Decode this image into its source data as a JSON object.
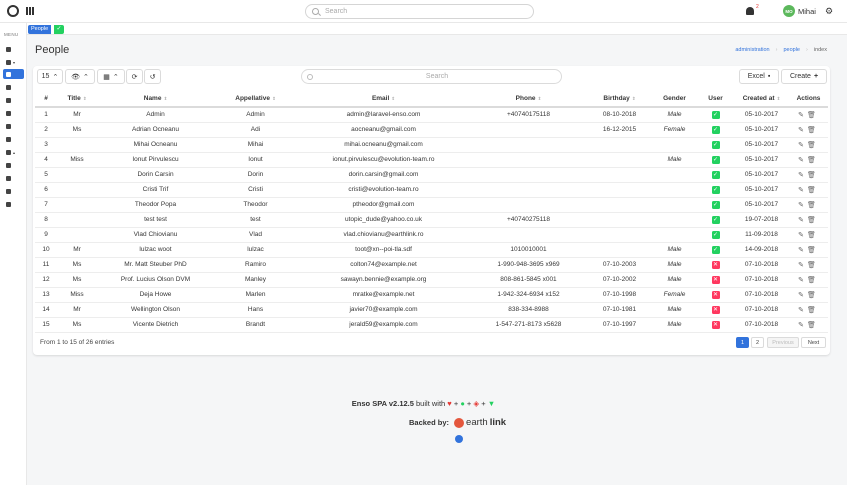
{
  "topbar": {
    "search_placeholder": "Search",
    "user": "Mihai",
    "avatar_initials": "MO",
    "notif_count": "2"
  },
  "sidebar": {
    "menu_label": "MENU"
  },
  "tabs": {
    "people": "People"
  },
  "page": {
    "title": "People",
    "breadcrumbs": [
      "administration",
      "people",
      "index"
    ]
  },
  "toolbar": {
    "per_page": "15",
    "search_placeholder": "Search",
    "excel": "Excel",
    "create": "Create"
  },
  "table": {
    "headers": [
      "#",
      "Title",
      "Name",
      "Appellative",
      "Email",
      "Phone",
      "Birthday",
      "Gender",
      "User",
      "Created at",
      "Actions"
    ],
    "rows": [
      {
        "n": "1",
        "title": "Mr",
        "name": "Admin",
        "app": "Admin",
        "email": "admin@laravel-enso.com",
        "phone": "+40740175118",
        "bday": "08-10-2018",
        "gender": "Male",
        "user": true,
        "created": "05-10-2017"
      },
      {
        "n": "2",
        "title": "Ms",
        "name": "Adrian Ocneanu",
        "app": "Adi",
        "email": "aocneanu@gmail.com",
        "phone": "",
        "bday": "16-12-2015",
        "gender": "Female",
        "user": true,
        "created": "05-10-2017"
      },
      {
        "n": "3",
        "title": "",
        "name": "Mihai Ocneanu",
        "app": "Mihai",
        "email": "mihai.ocneanu@gmail.com",
        "phone": "",
        "bday": "",
        "gender": "",
        "user": true,
        "created": "05-10-2017"
      },
      {
        "n": "4",
        "title": "Miss",
        "name": "Ionut Pirvulescu",
        "app": "Ionut",
        "email": "ionut.pirvulescu@evolution-team.ro",
        "phone": "",
        "bday": "",
        "gender": "Male",
        "user": true,
        "created": "05-10-2017"
      },
      {
        "n": "5",
        "title": "",
        "name": "Dorin Carsin",
        "app": "Dorin",
        "email": "dorin.carsin@gmail.com",
        "phone": "",
        "bday": "",
        "gender": "",
        "user": true,
        "created": "05-10-2017"
      },
      {
        "n": "6",
        "title": "",
        "name": "Cristi Trif",
        "app": "Cristi",
        "email": "cristi@evolution-team.ro",
        "phone": "",
        "bday": "",
        "gender": "",
        "user": true,
        "created": "05-10-2017"
      },
      {
        "n": "7",
        "title": "",
        "name": "Theodor Popa",
        "app": "Theodor",
        "email": "ptheodor@gmail.com",
        "phone": "",
        "bday": "",
        "gender": "",
        "user": true,
        "created": "05-10-2017"
      },
      {
        "n": "8",
        "title": "",
        "name": "test test",
        "app": "test",
        "email": "utopic_dude@yahoo.co.uk",
        "phone": "+40740275118",
        "bday": "",
        "gender": "",
        "user": true,
        "created": "19-07-2018"
      },
      {
        "n": "9",
        "title": "",
        "name": "Vlad Chiovianu",
        "app": "Vlad",
        "email": "vlad.chiovianu@earthlink.ro",
        "phone": "",
        "bday": "",
        "gender": "",
        "user": true,
        "created": "11-09-2018"
      },
      {
        "n": "10",
        "title": "Mr",
        "name": "lulzac woot",
        "app": "lulzac",
        "email": "toot@xn--poi-tla.sdf",
        "phone": "1010010001",
        "bday": "",
        "gender": "Male",
        "user": true,
        "created": "14-09-2018"
      },
      {
        "n": "11",
        "title": "Ms",
        "name": "Mr. Matt Steuber PhD",
        "app": "Ramiro",
        "email": "colton74@example.net",
        "phone": "1-990-948-3695 x969",
        "bday": "07-10-2003",
        "gender": "Male",
        "user": false,
        "created": "07-10-2018"
      },
      {
        "n": "12",
        "title": "Ms",
        "name": "Prof. Lucius Olson DVM",
        "app": "Manley",
        "email": "sawayn.bennie@example.org",
        "phone": "808-861-5845 x001",
        "bday": "07-10-2002",
        "gender": "Male",
        "user": false,
        "created": "07-10-2018"
      },
      {
        "n": "13",
        "title": "Miss",
        "name": "Deja Howe",
        "app": "Marlen",
        "email": "mratke@example.net",
        "phone": "1-942-324-6934 x152",
        "bday": "07-10-1998",
        "gender": "Female",
        "user": false,
        "created": "07-10-2018"
      },
      {
        "n": "14",
        "title": "Mr",
        "name": "Wellington Olson",
        "app": "Hans",
        "email": "javier70@example.com",
        "phone": "838-334-8988",
        "bday": "07-10-1981",
        "gender": "Male",
        "user": false,
        "created": "07-10-2018"
      },
      {
        "n": "15",
        "title": "Ms",
        "name": "Vicente Dietrich",
        "app": "Brandt",
        "email": "jerald59@example.com",
        "phone": "1-547-271-8173 x5628",
        "bday": "07-10-1997",
        "gender": "Male",
        "user": false,
        "created": "07-10-2018"
      }
    ]
  },
  "pagination": {
    "summary": "From 1 to 15 of 26 entries",
    "pages": [
      "1",
      "2"
    ],
    "prev": "Previous",
    "next": "Next"
  },
  "footer": {
    "version": "Enso SPA v2.12.5",
    "built_with": "built with",
    "backed_by": "Backed by:",
    "brand_a": "earth",
    "brand_b": "link"
  },
  "colors": {
    "accent": "#3273dc",
    "success": "#23d160",
    "danger": "#ff3860"
  }
}
